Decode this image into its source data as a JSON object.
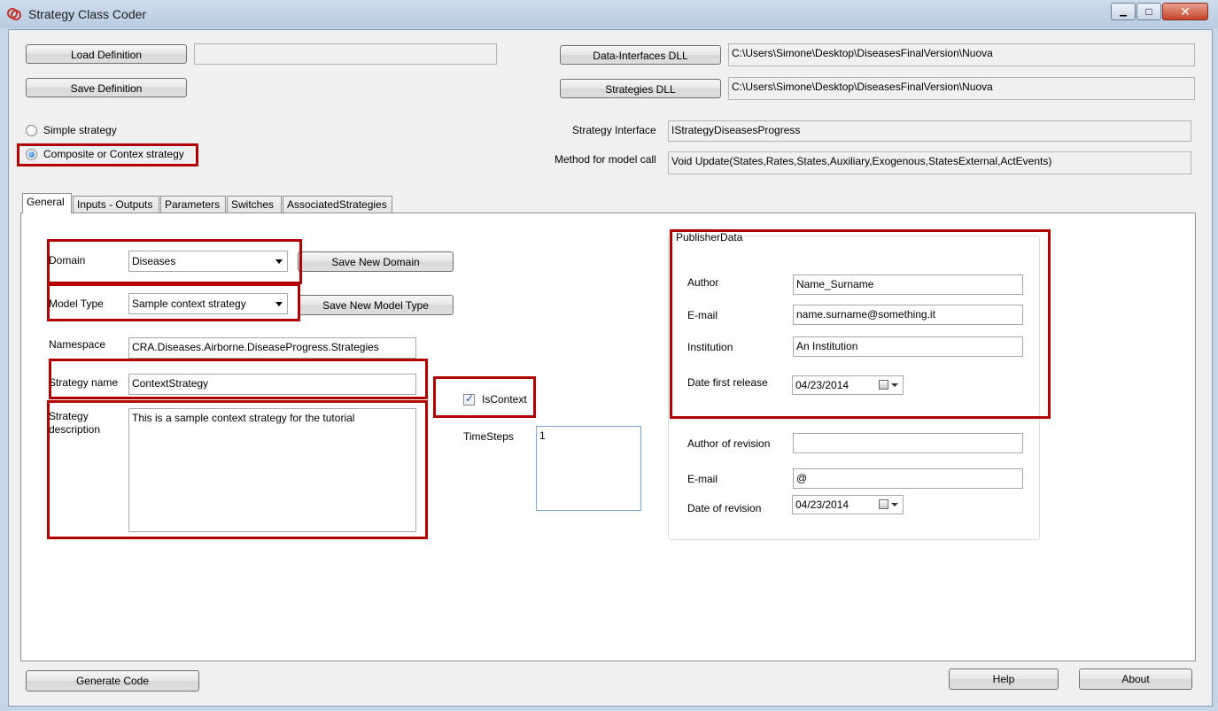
{
  "window": {
    "title": "Strategy Class Coder",
    "close_glyph": "✕",
    "min_glyph": "▁",
    "max_glyph": "□"
  },
  "top": {
    "load_definition_label": "Load Definition",
    "load_definition_value": "",
    "save_definition_label": "Save Definition",
    "data_interfaces_label": "Data-Interfaces DLL",
    "data_interfaces_value": "C:\\Users\\Simone\\Desktop\\DiseasesFinalVersion\\Nuova",
    "strategies_dll_label": "Strategies DLL",
    "strategies_dll_value": "C:\\Users\\Simone\\Desktop\\DiseasesFinalVersion\\Nuova",
    "simple_strategy_label": "Simple strategy",
    "composite_strategy_label": "Composite or Contex strategy",
    "strategy_interface_label": "Strategy Interface",
    "strategy_interface_value": "IStrategyDiseasesProgress",
    "method_label": "Method for model call",
    "method_value": "Void Update(States,Rates,States,Auxiliary,Exogenous,StatesExternal,ActEvents)"
  },
  "tabs": [
    "General",
    "Inputs - Outputs",
    "Parameters",
    "Switches",
    "AssociatedStrategies"
  ],
  "general": {
    "domain_label": "Domain",
    "domain_value": "Diseases",
    "save_domain_label": "Save New Domain",
    "model_type_label": "Model Type",
    "model_type_value": "Sample context strategy",
    "save_model_type_label": "Save New Model Type",
    "namespace_label": "Namespace",
    "namespace_value": "CRA.Diseases.Airborne.DiseaseProgress.Strategies",
    "strategy_name_label": "Strategy name",
    "strategy_name_value": "ContextStrategy",
    "description_label_1": "Strategy",
    "description_label_2": "description",
    "description_value": "This is a sample context strategy for the tutorial",
    "iscontext_label": "IsContext",
    "iscontext_checked": true,
    "timesteps_label": "TimeSteps",
    "timesteps_value": "1"
  },
  "publisher": {
    "title": "PublisherData",
    "author_label": "Author",
    "author_value": "Name_Surname",
    "email_label": "E-mail",
    "email_value": "name.surname@something.it",
    "institution_label": "Institution",
    "institution_value": "An Institution",
    "date_first_label": "Date first release",
    "date_first_value": "04/23/2014",
    "author_rev_label": "Author of revision",
    "author_rev_value": "",
    "email_rev_label": "E-mail",
    "email_rev_value": "@",
    "date_rev_label": "Date of revision",
    "date_rev_value": "04/23/2014"
  },
  "bottom": {
    "generate_label": "Generate Code",
    "help_label": "Help",
    "about_label": "About"
  },
  "colors": {
    "highlight": "#b00000",
    "accent": "#1a63b8"
  }
}
